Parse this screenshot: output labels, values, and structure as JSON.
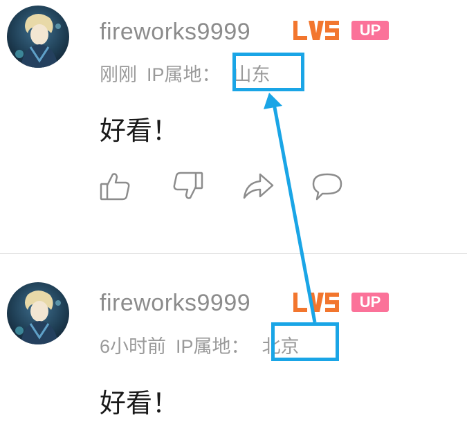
{
  "comments": [
    {
      "username": "fireworks9999",
      "level_badge": "LV5",
      "up_badge": "UP",
      "time": "刚刚",
      "ip_label": "IP属地：",
      "ip_location": "山东",
      "text": "好看！"
    },
    {
      "username": "fireworks9999",
      "level_badge": "LV5",
      "up_badge": "UP",
      "time": "6小时前",
      "ip_label": "IP属地：",
      "ip_location": "北京",
      "text": "好看！"
    }
  ],
  "actions": [
    "thumbs-up-icon",
    "thumbs-down-icon",
    "share-icon",
    "reply-icon"
  ],
  "colors": {
    "username": "#8c8c8c",
    "meta": "#9a9a9a",
    "level_badge": "#f2762e",
    "up_badge": "#fb7299",
    "annotation": "#1aa5e6",
    "icon": "#8c8c8c"
  }
}
